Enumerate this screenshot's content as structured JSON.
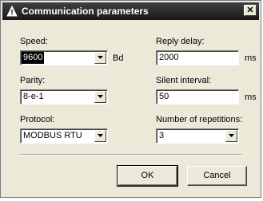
{
  "window": {
    "title": "Communication parameters",
    "close_label": "✕"
  },
  "speed": {
    "label": "Speed:",
    "value": "9600",
    "unit": "Bd"
  },
  "parity": {
    "label": "Parity:",
    "value": "8-e-1"
  },
  "protocol": {
    "label": "Protocol:",
    "value": "MODBUS RTU"
  },
  "reply_delay": {
    "label": "Reply delay:",
    "value": "2000",
    "unit": "ms"
  },
  "silent_interval": {
    "label": "Silent interval:",
    "value": "50",
    "unit": "ms"
  },
  "repetitions": {
    "label": "Number of repetitions:",
    "value": "3"
  },
  "buttons": {
    "ok": "OK",
    "cancel": "Cancel"
  }
}
